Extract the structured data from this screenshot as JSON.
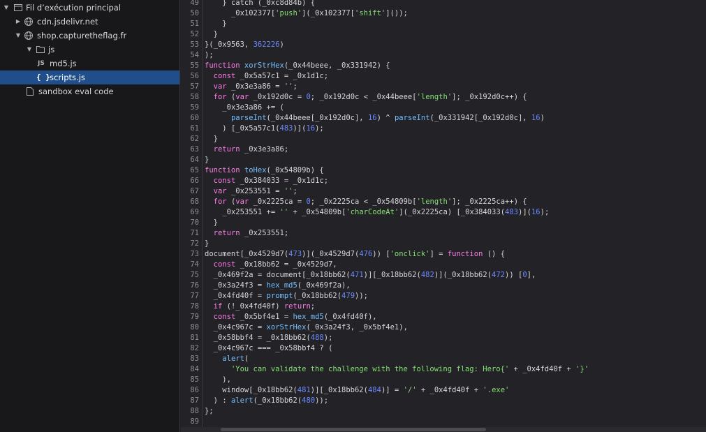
{
  "sidebar": {
    "items": [
      {
        "label": "Fil d’exécution principal",
        "icon": "window-icon",
        "twisty": "expanded"
      },
      {
        "label": "cdn.jsdelivr.net",
        "icon": "globe-icon",
        "twisty": "collapsed"
      },
      {
        "label": "shop.capturetheflag.fr",
        "icon": "globe-icon",
        "twisty": "expanded"
      },
      {
        "label": "js",
        "icon": "folder-icon",
        "twisty": "expanded"
      },
      {
        "label": "md5.js",
        "icon": "js-file-icon",
        "icon_text": "JS"
      },
      {
        "label": "scripts.js",
        "icon": "braces-file-icon",
        "icon_text": "{ }",
        "selected": true
      },
      {
        "label": "sandbox eval code",
        "icon": "file-icon"
      }
    ]
  },
  "editor": {
    "lines": [
      {
        "n": "49",
        "t": "    } catch (_0xc8d84b) {"
      },
      {
        "n": "50",
        "t": "      _0x102377['push'](_0x102377['shift']());"
      },
      {
        "n": "51",
        "t": "    }"
      },
      {
        "n": "52",
        "t": "  }"
      },
      {
        "n": "53",
        "t": "}(_0x9563, 362226)"
      },
      {
        "n": "54",
        "t": ");"
      },
      {
        "n": "55",
        "t": "function xorStrHex(_0x44beee, _0x331942) {"
      },
      {
        "n": "56",
        "t": "  const _0x5a57c1 = _0x1d1c;"
      },
      {
        "n": "57",
        "t": "  var _0x3e3a86 = '';"
      },
      {
        "n": "58",
        "t": "  for (var _0x192d0c = 0; _0x192d0c < _0x44beee['length']; _0x192d0c++) {"
      },
      {
        "n": "59",
        "t": "    _0x3e3a86 += ("
      },
      {
        "n": "60",
        "t": "      parseInt(_0x44beee[_0x192d0c], 16) ^ parseInt(_0x331942[_0x192d0c], 16)"
      },
      {
        "n": "61",
        "t": "    ) [_0x5a57c1(483)](16);"
      },
      {
        "n": "62",
        "t": "  }"
      },
      {
        "n": "63",
        "t": "  return _0x3e3a86;"
      },
      {
        "n": "64",
        "t": "}"
      },
      {
        "n": "65",
        "t": "function toHex(_0x54809b) {"
      },
      {
        "n": "66",
        "t": "  const _0x384033 = _0x1d1c;"
      },
      {
        "n": "67",
        "t": "  var _0x253551 = '';"
      },
      {
        "n": "68",
        "t": "  for (var _0x2225ca = 0; _0x2225ca < _0x54809b['length']; _0x2225ca++) {"
      },
      {
        "n": "69",
        "t": "    _0x253551 += '' + _0x54809b['charCodeAt'](_0x2225ca) [_0x384033(483)](16);"
      },
      {
        "n": "70",
        "t": "  }"
      },
      {
        "n": "71",
        "t": "  return _0x253551;"
      },
      {
        "n": "72",
        "t": "}"
      },
      {
        "n": "73",
        "t": "document[_0x4529d7(473)](_0x4529d7(476)) ['onclick'] = function () {"
      },
      {
        "n": "74",
        "t": "  const _0x18bb62 = _0x4529d7,"
      },
      {
        "n": "75",
        "t": "  _0x469f2a = document[_0x18bb62(471)][_0x18bb62(482)](_0x18bb62(472)) [0],"
      },
      {
        "n": "76",
        "t": "  _0x3a24f3 = hex_md5(_0x469f2a),"
      },
      {
        "n": "77",
        "t": "  _0x4fd40f = prompt(_0x18bb62(479));"
      },
      {
        "n": "78",
        "t": "  if (!_0x4fd40f) return;"
      },
      {
        "n": "79",
        "t": "  const _0x5bf4e1 = hex_md5(_0x4fd40f),"
      },
      {
        "n": "80",
        "t": "  _0x4c967c = xorStrHex(_0x3a24f3, _0x5bf4e1),"
      },
      {
        "n": "81",
        "t": "  _0x58bbf4 = _0x18bb62(488);"
      },
      {
        "n": "82",
        "t": "  _0x4c967c === _0x58bbf4 ? ("
      },
      {
        "n": "83",
        "t": "    alert("
      },
      {
        "n": "84",
        "t": "      'You can validate the challenge with the following flag: Hero{' + _0x4fd40f + '}'"
      },
      {
        "n": "85",
        "t": "    ),"
      },
      {
        "n": "86",
        "t": "    window[_0x18bb62(481)][_0x18bb62(484)] = '/' + _0x4fd40f + '.exe'"
      },
      {
        "n": "87",
        "t": "  ) : alert(_0x18bb62(480));"
      },
      {
        "n": "88",
        "t": "};"
      },
      {
        "n": "89",
        "t": ""
      }
    ]
  },
  "colors": {
    "keyword": "#ff7de9",
    "string": "#86de74",
    "number": "#6b89ff",
    "function_name": "#75bfff",
    "selection": "#204e8a"
  }
}
